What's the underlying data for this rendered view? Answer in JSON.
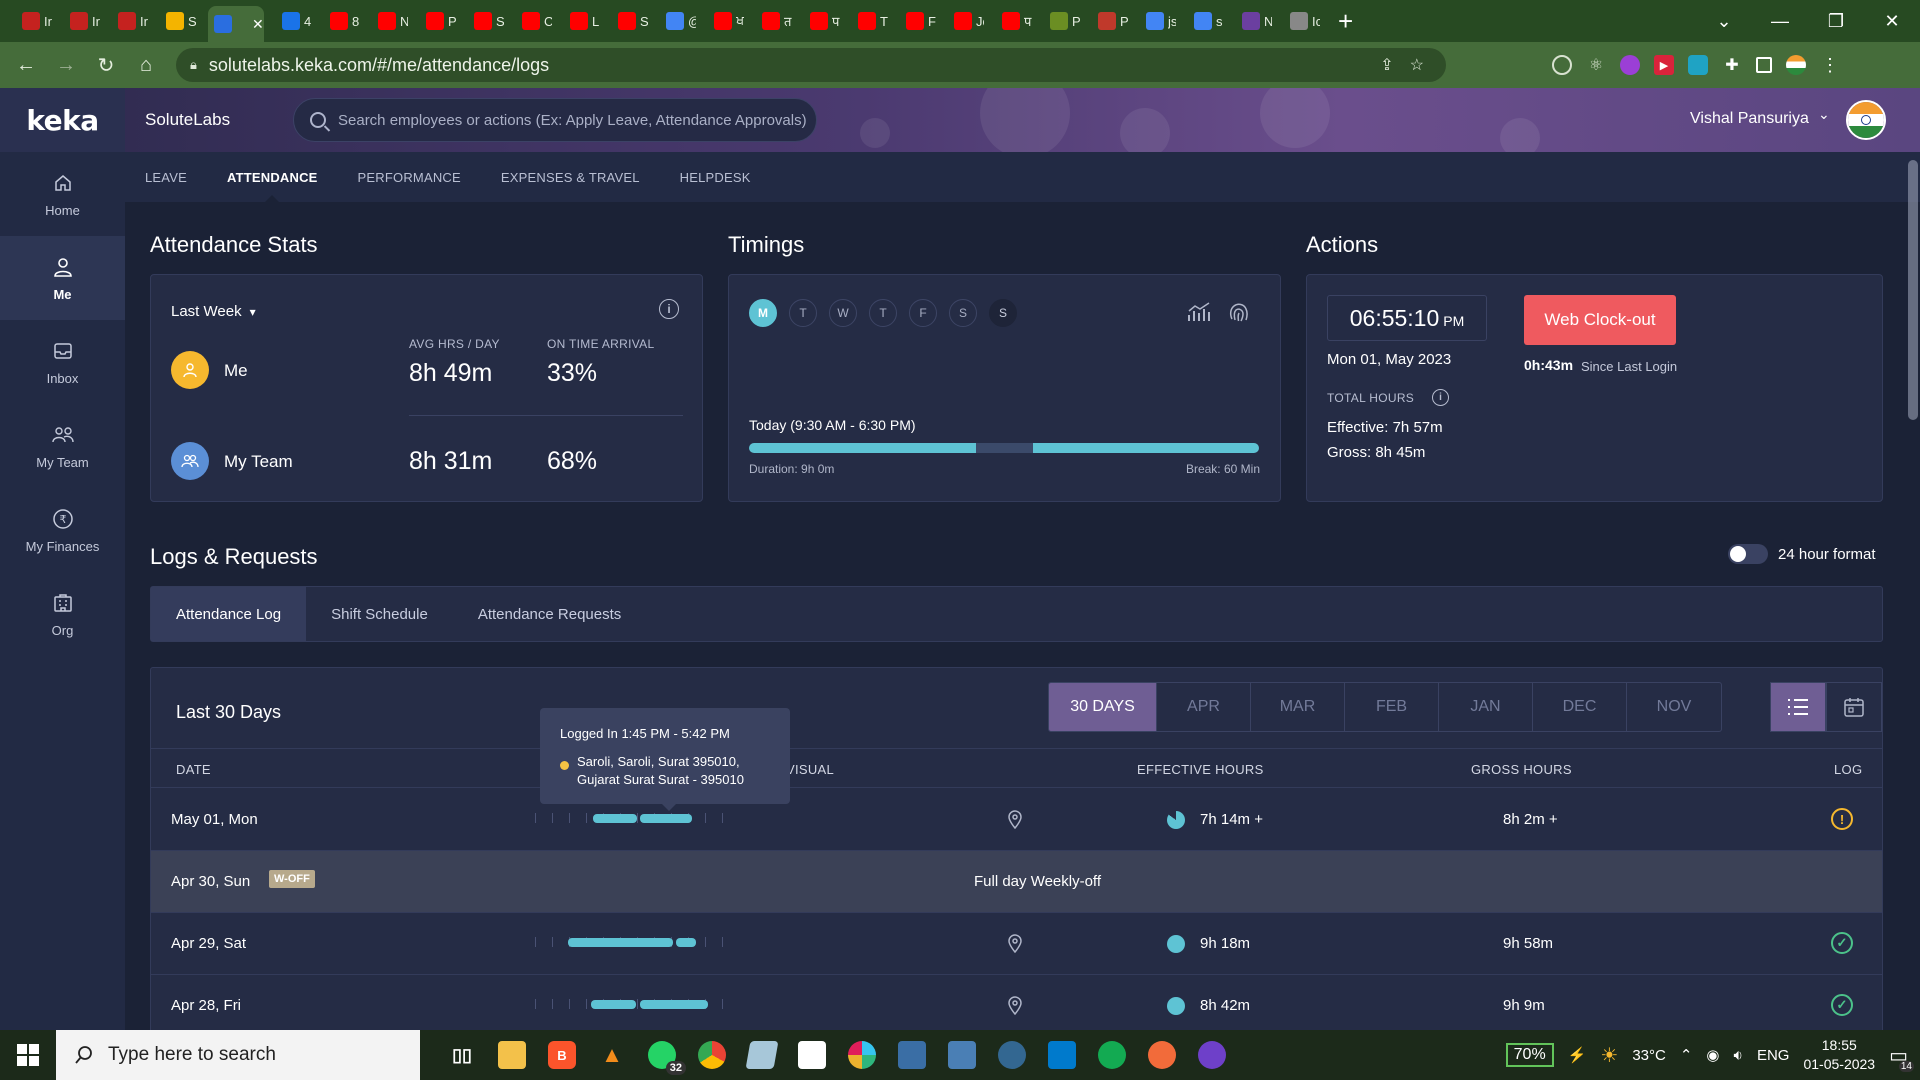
{
  "browser": {
    "tabs": [
      {
        "icon": "gmail-icon",
        "label": "Ir",
        "color": "#c5221f"
      },
      {
        "icon": "gmail-icon",
        "label": "Ir",
        "color": "#c5221f"
      },
      {
        "icon": "gmail-icon",
        "label": "Ir",
        "color": "#c5221f"
      },
      {
        "icon": "slides-icon",
        "label": "S",
        "color": "#f4b400"
      },
      {
        "icon": "keka-icon",
        "label": "",
        "color": "#2a6ee0",
        "active": true
      },
      {
        "icon": "app-icon",
        "label": "4",
        "color": "#1a73e8"
      },
      {
        "icon": "youtube-icon",
        "label": "8",
        "color": "#ff0000"
      },
      {
        "icon": "youtube-icon",
        "label": "N",
        "color": "#ff0000"
      },
      {
        "icon": "youtube-icon",
        "label": "P",
        "color": "#ff0000"
      },
      {
        "icon": "youtube-icon",
        "label": "S",
        "color": "#ff0000"
      },
      {
        "icon": "youtube-icon",
        "label": "C",
        "color": "#ff0000"
      },
      {
        "icon": "youtube-icon",
        "label": "L",
        "color": "#ff0000"
      },
      {
        "icon": "youtube-icon",
        "label": "S",
        "color": "#ff0000"
      },
      {
        "icon": "google-icon",
        "label": "@",
        "color": "#4285f4"
      },
      {
        "icon": "youtube-icon",
        "label": "ਖ",
        "color": "#ff0000"
      },
      {
        "icon": "youtube-icon",
        "label": "त",
        "color": "#ff0000"
      },
      {
        "icon": "youtube-icon",
        "label": "प",
        "color": "#ff0000"
      },
      {
        "icon": "youtube-icon",
        "label": "T",
        "color": "#ff0000"
      },
      {
        "icon": "youtube-icon",
        "label": "F",
        "color": "#ff0000"
      },
      {
        "icon": "youtube-icon",
        "label": "Jc",
        "color": "#ff0000"
      },
      {
        "icon": "youtube-icon",
        "label": "प",
        "color": "#ff0000"
      },
      {
        "icon": "app-icon",
        "label": "P",
        "color": "#6b8e23"
      },
      {
        "icon": "pdf-icon",
        "label": "P",
        "color": "#c0392b"
      },
      {
        "icon": "google-icon",
        "label": "js",
        "color": "#4285f4"
      },
      {
        "icon": "google-icon",
        "label": "s",
        "color": "#4285f4"
      },
      {
        "icon": "app-icon",
        "label": "N",
        "color": "#6b3fa0"
      },
      {
        "icon": "globe-icon",
        "label": "Ic",
        "color": "#888888"
      }
    ],
    "url": "solutelabs.keka.com/#/me/attendance/logs"
  },
  "header": {
    "logo": "keka",
    "company": "SoluteLabs",
    "search_placeholder": "Search employees or actions (Ex: Apply Leave, Attendance Approvals)",
    "user_name": "Vishal Pansuriya"
  },
  "sidebar": {
    "items": [
      {
        "label": "Home",
        "icon": "home-icon"
      },
      {
        "label": "Me",
        "icon": "user-icon",
        "active": true
      },
      {
        "label": "Inbox",
        "icon": "inbox-icon"
      },
      {
        "label": "My Team",
        "icon": "team-icon"
      },
      {
        "label": "My Finances",
        "icon": "rupee-icon"
      },
      {
        "label": "Org",
        "icon": "org-icon"
      }
    ]
  },
  "subnav": {
    "items": [
      "LEAVE",
      "ATTENDANCE",
      "PERFORMANCE",
      "EXPENSES & TRAVEL",
      "HELPDESK"
    ],
    "active": "ATTENDANCE"
  },
  "stats": {
    "title": "Attendance Stats",
    "period": "Last Week",
    "col_avg": "AVG HRS / DAY",
    "col_ontime": "ON TIME ARRIVAL",
    "me": {
      "name": "Me",
      "avg": "8h 49m",
      "ontime": "33%"
    },
    "team": {
      "name": "My Team",
      "avg": "8h 31m",
      "ontime": "68%"
    }
  },
  "timings": {
    "title": "Timings",
    "days": [
      "M",
      "T",
      "W",
      "T",
      "F",
      "S",
      "S"
    ],
    "today_label": "Today (9:30 AM - 6:30 PM)",
    "duration": "Duration: 9h 0m",
    "break": "Break: 60 Min",
    "break_start_fraction": 0.445,
    "break_end_fraction": 0.556
  },
  "actions": {
    "title": "Actions",
    "time": "06:55:10",
    "ampm": "PM",
    "date": "Mon 01, May 2023",
    "button": "Web Clock-out",
    "since_value": "0h:43m",
    "since_label": "Since Last Login",
    "total_hours_label": "TOTAL HOURS",
    "effective": "Effective: 7h 57m",
    "gross": "Gross: 8h 45m"
  },
  "logs": {
    "title": "Logs & Requests",
    "toggle_label": "24 hour format",
    "tabs": [
      "Attendance Log",
      "Shift Schedule",
      "Attendance Requests"
    ],
    "period_title": "Last 30 Days",
    "months": [
      "30 DAYS",
      "APR",
      "MAR",
      "FEB",
      "JAN",
      "DEC",
      "NOV"
    ],
    "columns": {
      "date": "DATE",
      "visual": "VISUAL",
      "effective": "EFFECTIVE HOURS",
      "gross": "GROSS HOURS",
      "log": "LOG"
    },
    "tooltip": {
      "line1": "Logged In 1:45 PM - 5:42 PM",
      "line2": "Saroli, Saroli, Surat 395010, Gujarat Surat Surat - 395010"
    },
    "rows": [
      {
        "date": "May 01, Mon",
        "effective": "7h 14m +",
        "gross": "8h 2m +",
        "status": "warning",
        "pie": "partial"
      },
      {
        "date": "Apr 30, Sun",
        "weekly_off": true,
        "badge": "W-OFF",
        "text": "Full day Weekly-off"
      },
      {
        "date": "Apr 29, Sat",
        "effective": "9h 18m",
        "gross": "9h 58m",
        "status": "ok",
        "pie": "full"
      },
      {
        "date": "Apr 28, Fri",
        "effective": "8h 42m",
        "gross": "9h 9m",
        "status": "ok",
        "pie": "full"
      }
    ]
  },
  "taskbar": {
    "search_placeholder": "Type here to search",
    "whatsapp_badge": "32",
    "battery": "70%",
    "weather": "33°C",
    "lang": "ENG",
    "time": "18:55",
    "date": "01-05-2023",
    "notifications": "14"
  }
}
